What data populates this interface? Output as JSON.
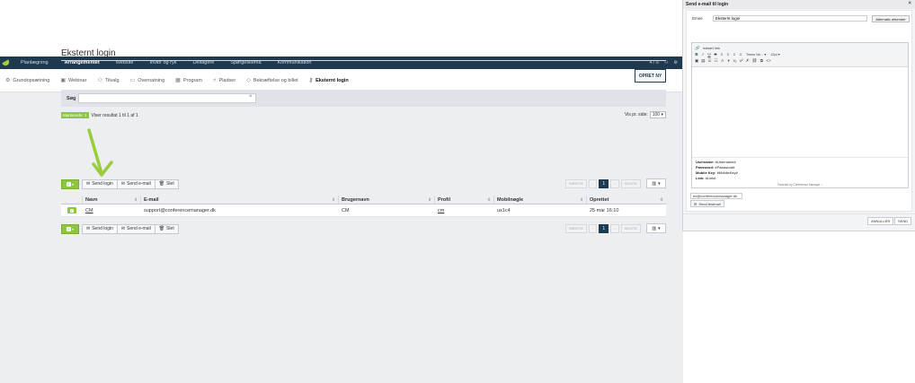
{
  "topnav": {
    "items": [
      "Planlægning",
      "Arrangementet",
      "Website",
      "Invibr og ryk",
      "Deltagere",
      "Spørgeskema",
      "Kommunikation"
    ],
    "active_index": 1,
    "right_text": "4 / ∞"
  },
  "subnav": {
    "items": [
      {
        "label": "Grundopsætning",
        "icon": "gear-icon"
      },
      {
        "label": "Webinar",
        "icon": "camera-icon"
      },
      {
        "label": "Tilvalg",
        "icon": "users-icon"
      },
      {
        "label": "Overnatning",
        "icon": "bed-icon"
      },
      {
        "label": "Program",
        "icon": "calendar-icon"
      },
      {
        "label": "Pladser",
        "icon": "seat-icon"
      },
      {
        "label": "Bekræftelse og billet",
        "icon": "tag-icon"
      },
      {
        "label": "Eksternt login",
        "icon": "key-icon"
      }
    ],
    "active_index": 7
  },
  "page": {
    "title": "Eksternt login",
    "create_label": "OPRET NY"
  },
  "search": {
    "label": "Søg",
    "value": "",
    "clear": "×"
  },
  "results": {
    "marked_label": "Markerede: 1",
    "text": "Viser resultat 1 til 1 af 1",
    "per_page_label": "Vis pr. side:",
    "per_page_value": "100"
  },
  "toolbar": {
    "send_login": "Send login",
    "send_email": "Send e-mail",
    "delete": "Slet"
  },
  "pager": {
    "first": "FØRSTE",
    "prev": "‹",
    "current": "1",
    "next": "›",
    "last": "SIDSTE"
  },
  "table": {
    "columns": [
      "Navn",
      "E-mail",
      "Brugernavn",
      "Profil",
      "Mobilnøgle",
      "Oprettet"
    ],
    "rows": [
      {
        "navn": "CM",
        "email": "support@conferencemanager.dk",
        "brugernavn": "CM",
        "profil": "cm",
        "mobilnogle": "ux1c4",
        "oprettet": "25 mar 16:10"
      }
    ]
  },
  "modal": {
    "title": "Send e-mail til login",
    "close": "×",
    "subject_label": "Emne",
    "subject_value": "Eksternt login",
    "alt_sender": "Alternativ afsender",
    "insert_link": "Indsæt link",
    "font_name": "Times Ne...",
    "font_size": "12pt",
    "body": {
      "username_label": "Username:",
      "username_value": "#Username#",
      "password_label": "Password:",
      "password_value": "#Password#",
      "mobile_label": "Mobile Key:",
      "mobile_value": "#MobileKey#",
      "link_label": "Link:",
      "link_value": "#Link#"
    },
    "powered": "Powered by Conference Manager",
    "test_email": "ex@conferencemanager.dk",
    "send_test": "Send testmail",
    "cancel": "ANNULLÉR",
    "send": "SEND"
  },
  "colors": {
    "nav_bg": "#1f3a4f",
    "accent_green": "#8dc63f",
    "annotation_arrow": "#9acd3a"
  }
}
